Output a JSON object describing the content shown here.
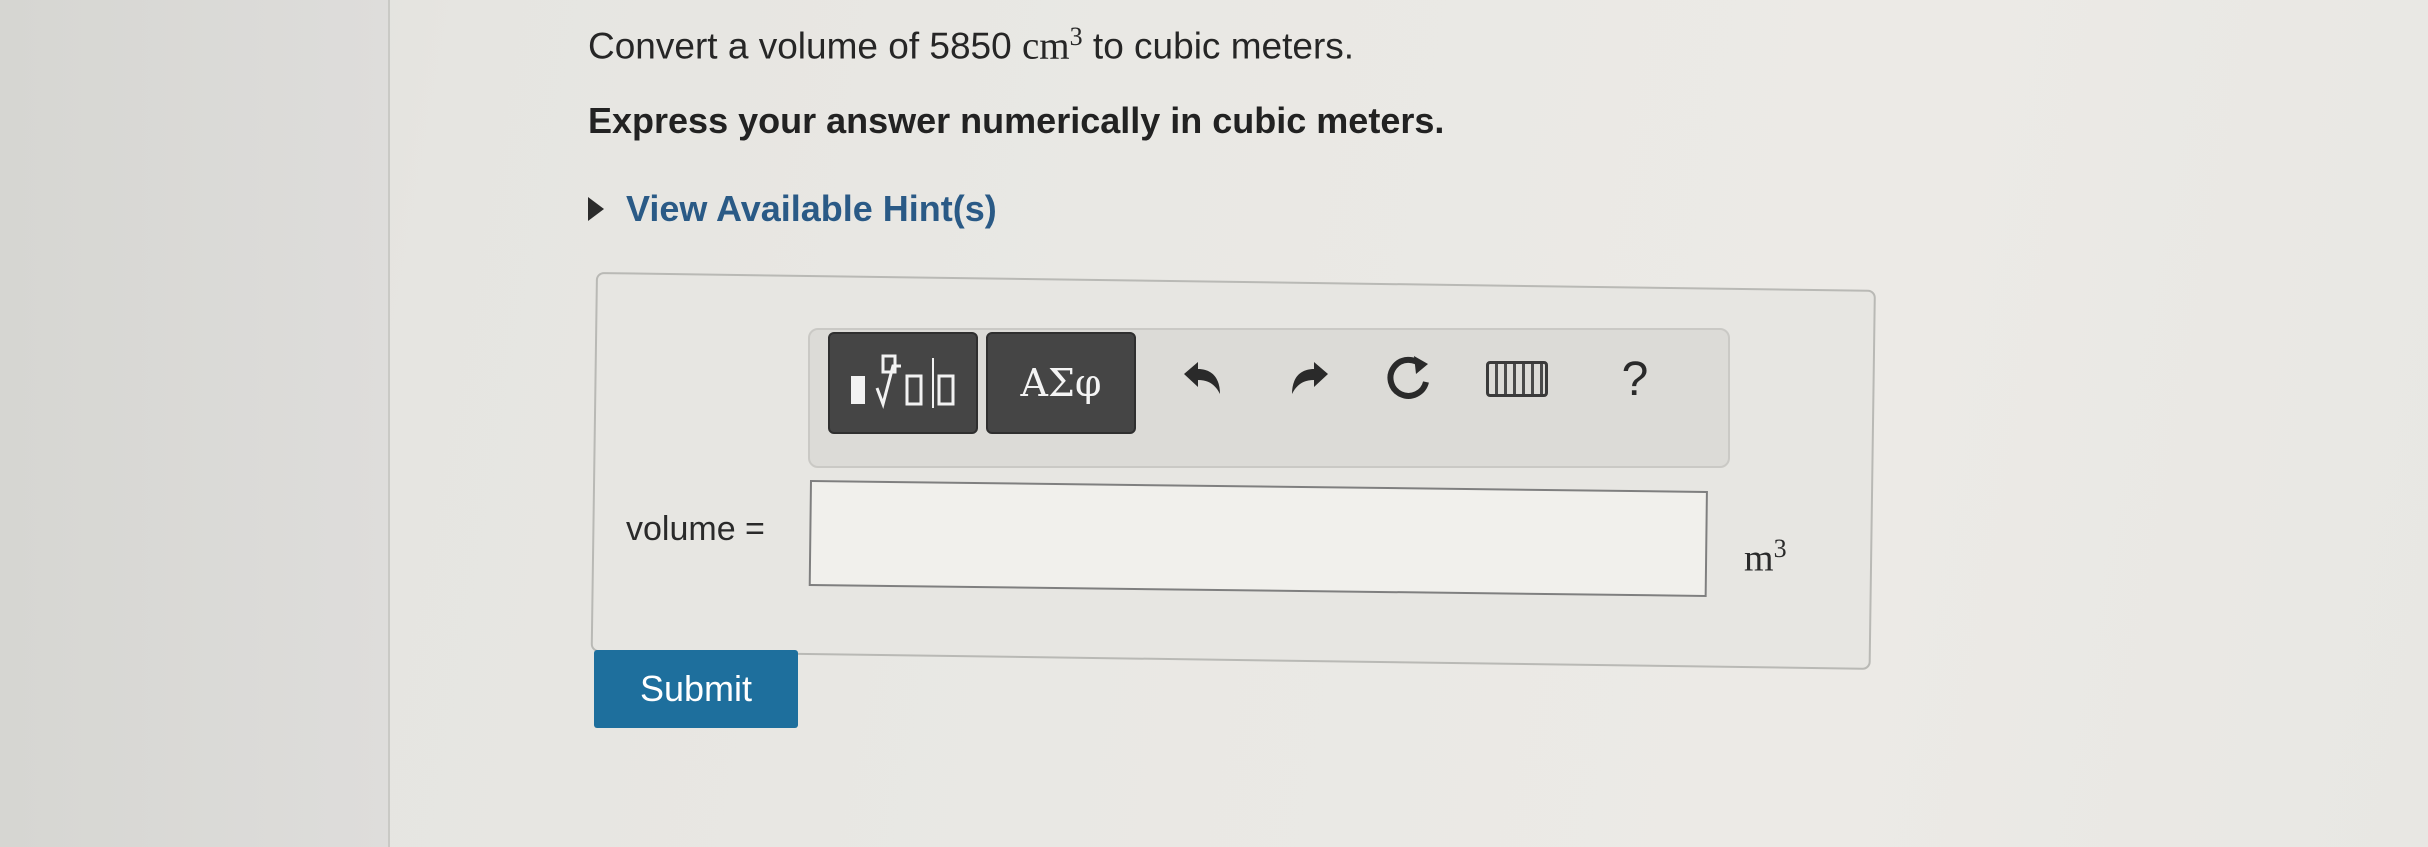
{
  "question": {
    "prefix": "Convert a volume of 5850",
    "unit_base": "cm",
    "unit_exp": "3",
    "suffix": "to cubic meters."
  },
  "instruction": "Express your answer numerically in cubic meters.",
  "hint": {
    "label": "View Available Hint(s)",
    "icon": "triangle-right-icon"
  },
  "toolbar": {
    "greek_label": "ΑΣφ",
    "help_label": "?",
    "icons": [
      "template-icon",
      "greek-symbols",
      "undo-icon",
      "redo-icon",
      "reset-icon",
      "keyboard-icon",
      "help-icon"
    ]
  },
  "answer": {
    "label": "volume =",
    "value": "",
    "unit_base": "m",
    "unit_exp": "3"
  },
  "submit_label": "Submit",
  "colors": {
    "link": "#2a5a86",
    "submit": "#1e6f9d",
    "toolbar_button": "#454545"
  }
}
